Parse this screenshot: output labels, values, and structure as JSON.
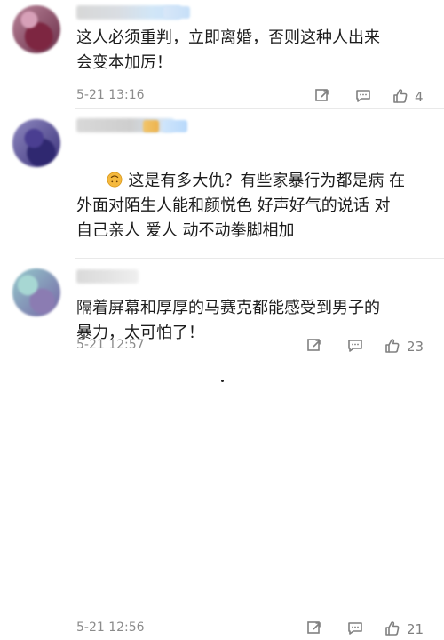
{
  "comments": [
    {
      "text": "这人必须重判，立即离婚，否则这种人出来\n会变本加厉！",
      "timestamp": "5-21 13:16",
      "likes": "4",
      "icons": {
        "share": "share-icon",
        "comment": "comment-icon",
        "like": "like-icon"
      }
    },
    {
      "text": "这是有多大仇？有些家暴行为都是病 在\n外面对陌生人能和颜悦色 好声好气的说话 对\n自己亲人 爱人 动不动拳脚相加",
      "timestamp": "5-21 12:57",
      "likes": "23",
      "icons": {
        "emoji": "upside-down-face-icon",
        "share": "share-icon",
        "comment": "comment-icon",
        "like": "like-icon"
      }
    },
    {
      "text": "隔着屏幕和厚厚的马赛克都能感受到男子的\n暴力，太可怕了！",
      "timestamp": "5-21 12:56",
      "likes": "21",
      "icons": {
        "share": "share-icon",
        "comment": "comment-icon",
        "like": "like-icon"
      }
    }
  ],
  "colors": {
    "text": "#1c1c1c",
    "meta": "#8b8b8b",
    "icon": "#808080",
    "divider": "#e9e9e9"
  }
}
